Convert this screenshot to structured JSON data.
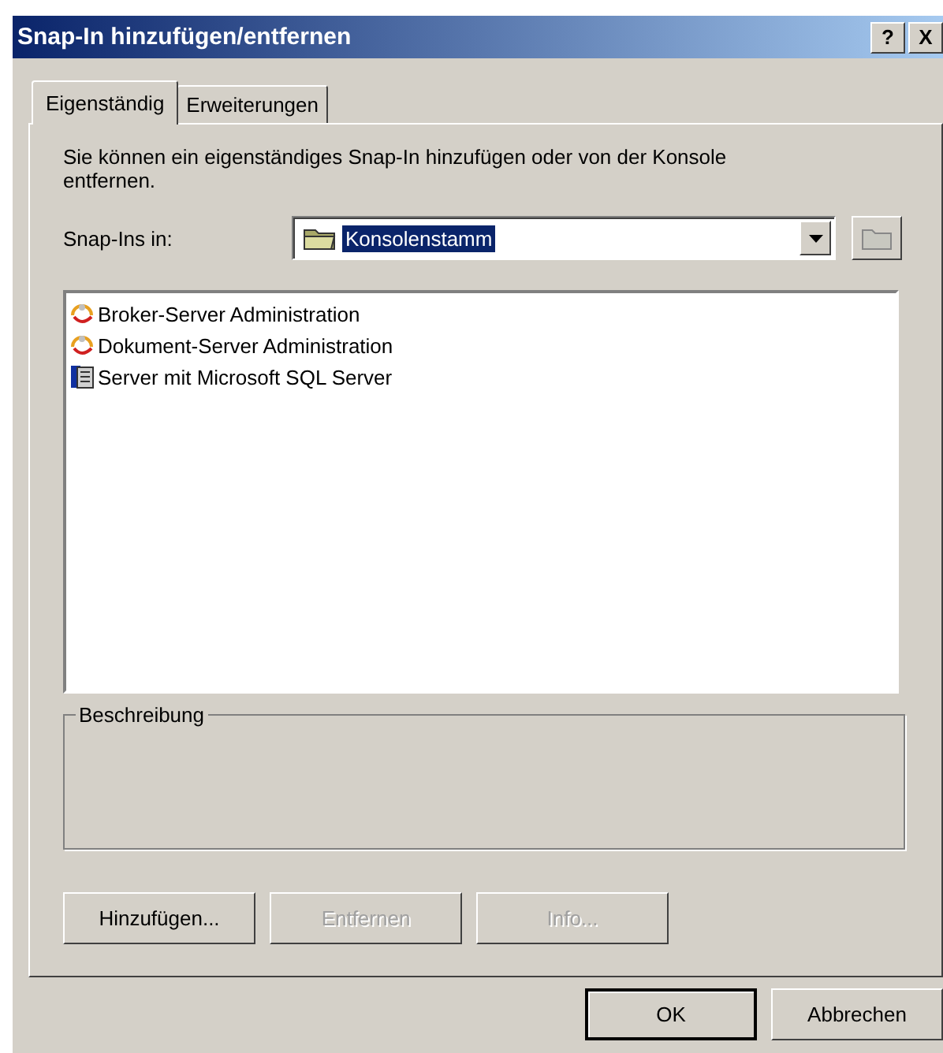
{
  "window": {
    "title": "Snap-In hinzufügen/entfernen",
    "title_buttons": [
      "?",
      "X"
    ]
  },
  "tabs": [
    {
      "label": "Eigenständig",
      "selected": true
    },
    {
      "label": "Erweiterungen",
      "selected": false
    }
  ],
  "intro": "Sie können ein eigenständiges Snap-In hinzufügen oder von der Konsole entfernen.",
  "snapins_in": {
    "label": "Snap-Ins in:",
    "value": "Konsolenstamm"
  },
  "snapins": [
    {
      "label": "Broker-Server Administration",
      "kind": "tool"
    },
    {
      "label": "Dokument-Server Administration",
      "kind": "tool"
    },
    {
      "label": "Server mit Microsoft SQL Server",
      "kind": "server"
    }
  ],
  "description": {
    "label": "Beschreibung"
  },
  "actions": [
    {
      "label": "Hinzufügen...",
      "disabled": false
    },
    {
      "label": "Entfernen",
      "disabled": true
    },
    {
      "label": "Info...",
      "disabled": true
    }
  ],
  "buttons": [
    {
      "label": "OK",
      "default": true
    },
    {
      "label": "Abbrechen",
      "default": false
    }
  ]
}
